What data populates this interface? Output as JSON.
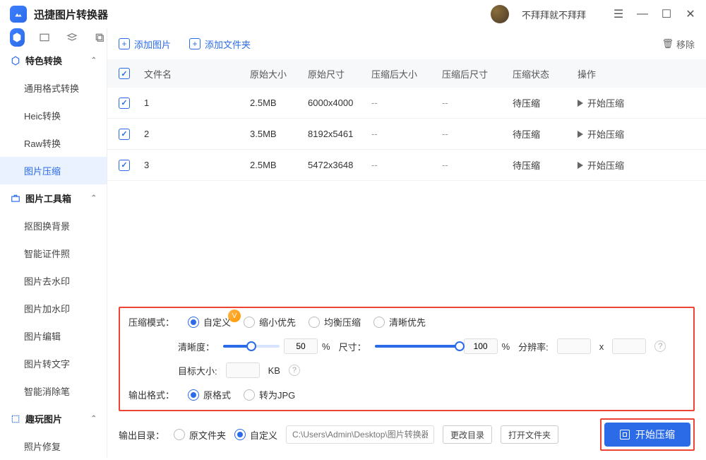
{
  "app": {
    "title": "迅捷图片转换器",
    "user": "不拜拜就不拜拜"
  },
  "sidebar": {
    "group1": {
      "title": "特色转换",
      "items": [
        "通用格式转换",
        "Heic转换",
        "Raw转换",
        "图片压缩"
      ]
    },
    "group2": {
      "title": "图片工具箱",
      "items": [
        "抠图换背景",
        "智能证件照",
        "图片去水印",
        "图片加水印",
        "图片编辑",
        "图片转文字",
        "智能消除笔"
      ]
    },
    "group3": {
      "title": "趣玩图片",
      "items": [
        "照片修复"
      ]
    }
  },
  "toolbar": {
    "add_image": "添加图片",
    "add_folder": "添加文件夹",
    "remove": "移除"
  },
  "table": {
    "headers": {
      "filename": "文件名",
      "orig_size": "原始大小",
      "orig_dim": "原始尺寸",
      "c_size": "压缩后大小",
      "c_dim": "压缩后尺寸",
      "status": "压缩状态",
      "action": "操作"
    },
    "rows": [
      {
        "name": "1",
        "size": "2.5MB",
        "dim": "6000x4000",
        "csize": "--",
        "cdim": "--",
        "status": "待压缩",
        "action": "开始压缩"
      },
      {
        "name": "2",
        "size": "3.5MB",
        "dim": "8192x5461",
        "csize": "--",
        "cdim": "--",
        "status": "待压缩",
        "action": "开始压缩"
      },
      {
        "name": "3",
        "size": "2.5MB",
        "dim": "5472x3648",
        "csize": "--",
        "cdim": "--",
        "status": "待压缩",
        "action": "开始压缩"
      }
    ]
  },
  "settings": {
    "mode_label": "压缩模式：",
    "modes": {
      "custom": "自定义",
      "shrink": "缩小优先",
      "balance": "均衡压缩",
      "clear": "清晰优先"
    },
    "clarity_label": "清晰度：",
    "clarity_value": "50",
    "pct": "%",
    "size_label": "尺寸：",
    "size_value": "100",
    "res_label": "分辨率:",
    "x": "x",
    "target_label": "目标大小:",
    "kb": "KB",
    "fmt_label": "输出格式：",
    "fmt_orig": "原格式",
    "fmt_jpg": "转为JPG",
    "out_label": "输出目录：",
    "out_orig": "原文件夹",
    "out_custom": "自定义",
    "path_placeholder": "C:\\Users\\Admin\\Desktop\\图片转换器",
    "change_dir": "更改目录",
    "open_dir": "打开文件夹",
    "start": "开始压缩"
  }
}
